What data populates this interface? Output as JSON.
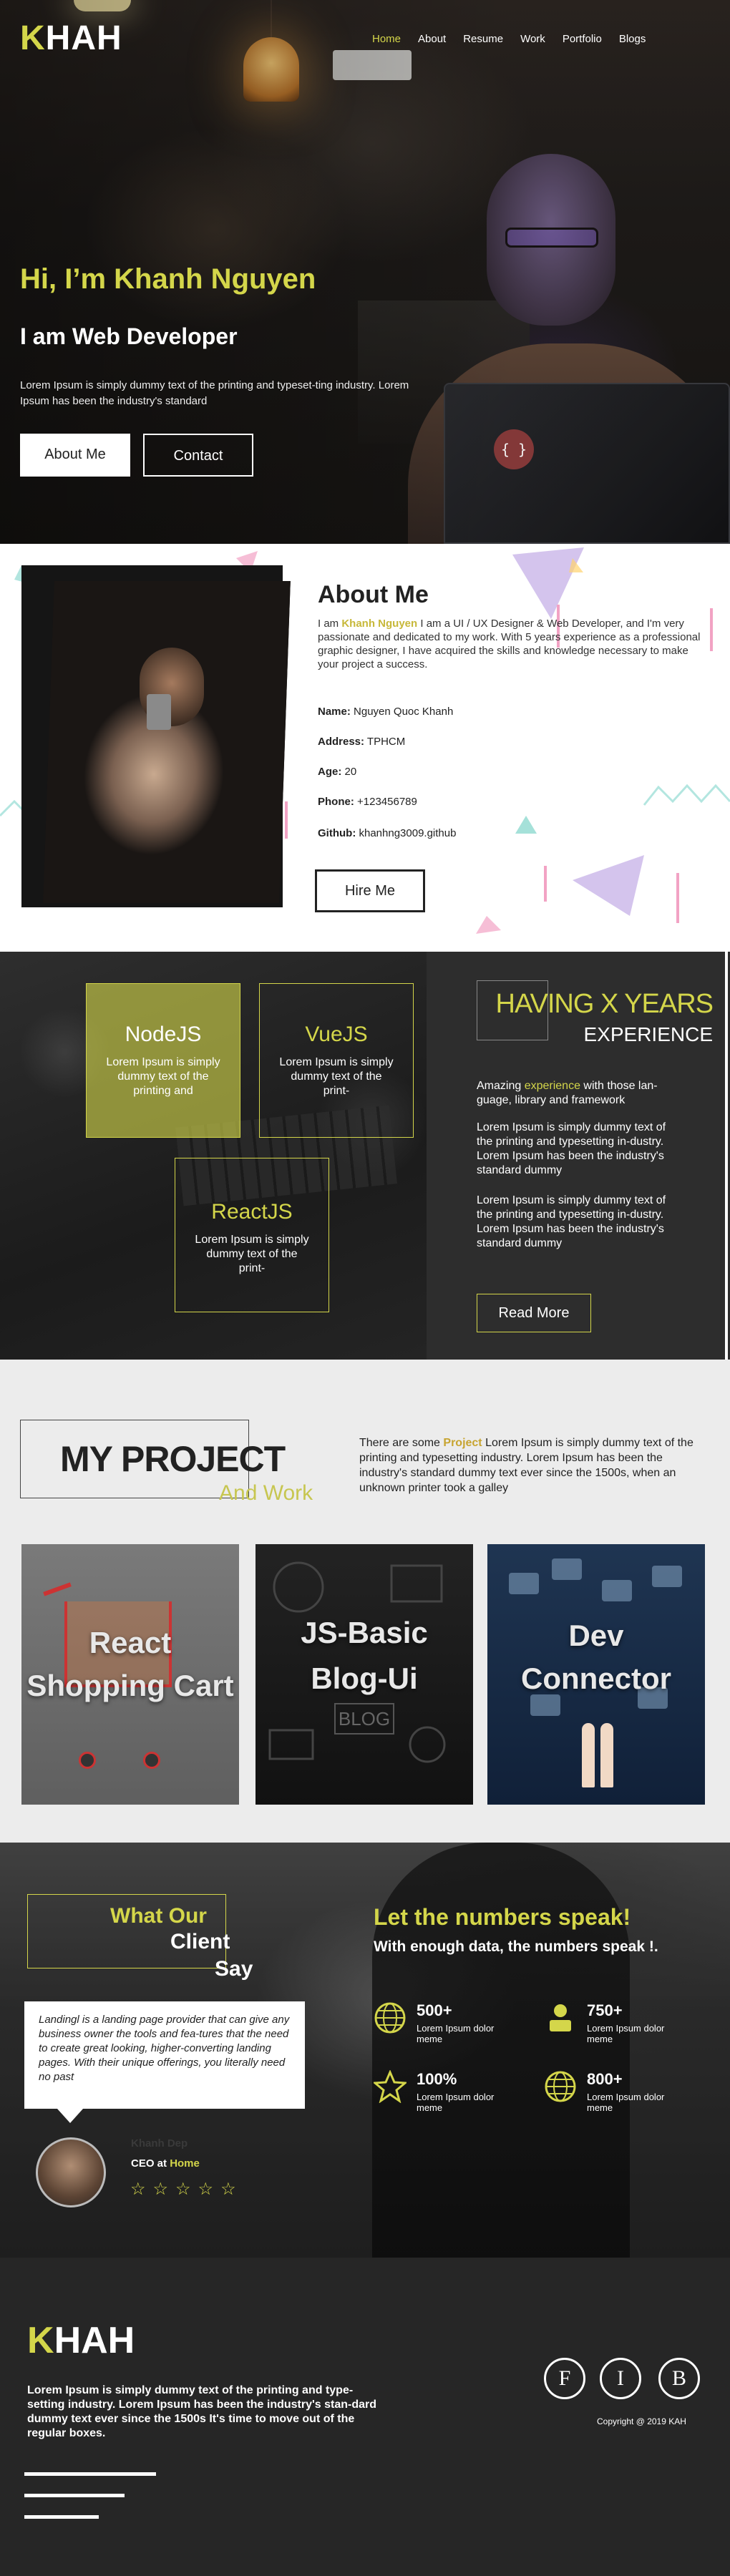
{
  "brand": {
    "first": "K",
    "rest": "HAH"
  },
  "nav": [
    "Home",
    "About",
    "Resume",
    "Work",
    "Portfolio",
    "Blogs"
  ],
  "hero": {
    "title": "Hi, I’m Khanh Nguyen",
    "subtitle": "I am Web Developer",
    "desc": "Lorem Ipsum is simply dummy text of the printing and typeset-ting industry. Lorem Ipsum has been the industry's standard",
    "btn_about": "About Me",
    "btn_contact": "Contact",
    "laptop_logo": "{ }"
  },
  "about": {
    "title": "About Me",
    "intro_pre": "I am ",
    "intro_name": "Khanh Nguyen",
    "intro_post": " I am a UI / UX Designer & Web Developer, and I'm very passionate and dedicated to my work. With 5 years experience as a professional graphic designer, I have acquired the skills and knowledge necessary to make your project a success.",
    "info": [
      {
        "label": "Name:",
        "value": " Nguyen Quoc Khanh"
      },
      {
        "label": "Address:",
        "value": " TPHCM"
      },
      {
        "label": "Age:",
        "value": " 20"
      },
      {
        "label": "Phone:",
        "value": " +123456789"
      },
      {
        "label": "Github:",
        "value": " khanhng3009.github"
      }
    ],
    "hire": "Hire Me"
  },
  "skills": {
    "cards": [
      {
        "title": "NodeJS",
        "text": "Lorem Ipsum is simply dummy text of the printing and"
      },
      {
        "title": "VueJS",
        "text": "Lorem Ipsum is simply dummy text of the print-"
      },
      {
        "title": "ReactJS",
        "text": "Lorem Ipsum is simply dummy text of the print-"
      }
    ],
    "exp_title": "HAVING X YEARS",
    "exp_sub": "EXPERIENCE",
    "p1_pre": "Amazing ",
    "p1_highlight": "experience",
    "p1_post": " with  those lan-guage, library and framework",
    "p2": "Lorem Ipsum is simply dummy text of the printing and typesetting in-dustry. Lorem Ipsum has been the industry's standard dummy",
    "p3": "Lorem Ipsum is simply dummy text of the printing and typesetting in-dustry. Lorem Ipsum has been the industry's standard dummy",
    "more": "Read More"
  },
  "projects": {
    "title": "MY PROJECT",
    "tag": "And Work",
    "desc_pre": "There are some ",
    "desc_highlight": "Project",
    "desc_post": " Lorem Ipsum is simply dummy text of the printing and typesetting industry. Lorem Ipsum has been the industry's standard dummy text ever since the 1500s, when an unknown printer took a galley",
    "cards": [
      {
        "l1": "React",
        "l2": "Shopping Cart"
      },
      {
        "l1": "JS-Basic",
        "l2": "Blog-Ui"
      },
      {
        "l1": "Dev",
        "l2": "Connector"
      }
    ],
    "blog_word": "BLOG"
  },
  "testimonial": {
    "t1": "What Our",
    "t2": "Client",
    "t3": "Say",
    "quote": "Landingl is a landing page provider that can give any business owner the tools and fea-tures that the need to create great looking, higher-converting landing pages. With their unique offerings, you literally need no past",
    "name": "Khanh Dep",
    "role_pre": "CEO at ",
    "role_link": "Home",
    "stars": "☆☆☆☆☆"
  },
  "numbers": {
    "title": "Let the numbers speak!",
    "sub": "With enough data, the numbers speak !.",
    "items": [
      {
        "num": "500+",
        "label": "Lorem Ipsum dolor meme",
        "icon": "globe-icon"
      },
      {
        "num": "750+",
        "label": "Lorem Ipsum dolor meme",
        "icon": "user-icon"
      },
      {
        "num": "100%",
        "label": "Lorem Ipsum dolor meme",
        "icon": "star-icon"
      },
      {
        "num": "800+",
        "label": "Lorem Ipsum dolor meme",
        "icon": "globe-icon"
      }
    ]
  },
  "footer": {
    "text": "Lorem Ipsum is simply dummy text of the printing and type-setting industry. Lorem Ipsum has been the industry's stan-dard dummy text ever since the 1500s It's time to move out of the regular boxes.",
    "social": [
      "F",
      "I",
      "B"
    ],
    "copyright": "Copyright @ 2019  KAH"
  },
  "colors": {
    "accent": "#d4d64a",
    "dark": "#262626"
  }
}
